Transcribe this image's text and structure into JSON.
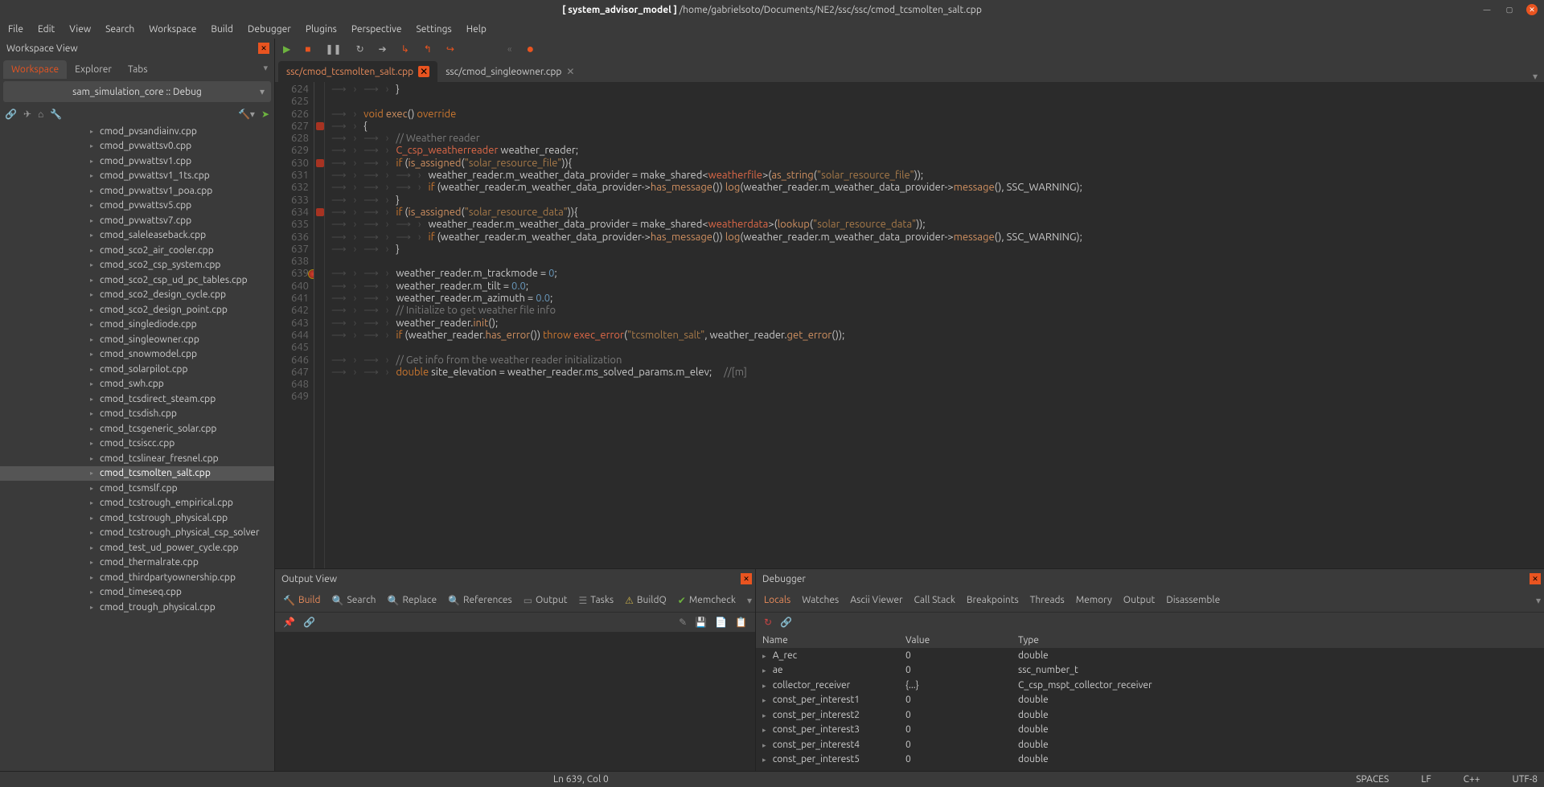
{
  "title_prefix": "[ system_advisor_model ]",
  "title_path": " /home/gabrielsoto/Documents/NE2/ssc/ssc/cmod_tcsmolten_salt.cpp",
  "menu": [
    "File",
    "Edit",
    "View",
    "Search",
    "Workspace",
    "Build",
    "Debugger",
    "Plugins",
    "Perspective",
    "Settings",
    "Help"
  ],
  "workspace": {
    "header": "Workspace View",
    "tabs": [
      "Workspace",
      "Explorer",
      "Tabs"
    ],
    "active_tab": 0,
    "selected_target": "sam_simulation_core :: Debug",
    "files": [
      "cmod_pvsandiainv.cpp",
      "cmod_pvwattsv0.cpp",
      "cmod_pvwattsv1.cpp",
      "cmod_pvwattsv1_1ts.cpp",
      "cmod_pvwattsv1_poa.cpp",
      "cmod_pvwattsv5.cpp",
      "cmod_pvwattsv7.cpp",
      "cmod_saleleaseback.cpp",
      "cmod_sco2_air_cooler.cpp",
      "cmod_sco2_csp_system.cpp",
      "cmod_sco2_csp_ud_pc_tables.cpp",
      "cmod_sco2_design_cycle.cpp",
      "cmod_sco2_design_point.cpp",
      "cmod_singlediode.cpp",
      "cmod_singleowner.cpp",
      "cmod_snowmodel.cpp",
      "cmod_solarpilot.cpp",
      "cmod_swh.cpp",
      "cmod_tcsdirect_steam.cpp",
      "cmod_tcsdish.cpp",
      "cmod_tcsgeneric_solar.cpp",
      "cmod_tcsiscc.cpp",
      "cmod_tcslinear_fresnel.cpp",
      "cmod_tcsmolten_salt.cpp",
      "cmod_tcsmslf.cpp",
      "cmod_tcstrough_empirical.cpp",
      "cmod_tcstrough_physical.cpp",
      "cmod_tcstrough_physical_csp_solver",
      "cmod_test_ud_power_cycle.cpp",
      "cmod_thermalrate.cpp",
      "cmod_thirdpartyownership.cpp",
      "cmod_timeseq.cpp",
      "cmod_trough_physical.cpp"
    ],
    "selected_file_index": 23
  },
  "editor_tabs": [
    {
      "label": "ssc/cmod_tcsmolten_salt.cpp",
      "active": true
    },
    {
      "label": "ssc/cmod_singleowner.cpp",
      "active": false
    }
  ],
  "editor": {
    "first_line": 624,
    "breakpoint_line": 639,
    "fold_lines": [
      627,
      630,
      634
    ],
    "lines_html": [
      "        }",
      "",
      "    <span class='kw'>void</span> <span class='fn'>exec</span>() <span class='kw'>override</span>",
      "    {",
      "        <span class='cmt'>// Weather reader</span>",
      "        <span class='cls'>C_csp_weatherreader</span> weather_reader;",
      "        <span class='kw'>if</span> (<span class='fn'>is_assigned</span>(<span class='str'>\"solar_resource_file\"</span>)){",
      "            weather_reader.m_weather_data_provider = make_shared&lt;<span class='cls'>weatherfile</span>&gt;(<span class='fn'>as_string</span>(<span class='str'>\"solar_resource_file\"</span>));",
      "            <span class='kw'>if</span> (weather_reader.m_weather_data_provider-&gt;<span class='fn'>has_message</span>()) <span class='log'>log</span>(weather_reader.m_weather_data_provider-&gt;<span class='fn'>message</span>(), SSC_WARNING);",
      "        }",
      "        <span class='kw'>if</span> (<span class='fn'>is_assigned</span>(<span class='str'>\"solar_resource_data\"</span>)){",
      "            weather_reader.m_weather_data_provider = make_shared&lt;<span class='cls'>weatherdata</span>&gt;(<span class='fn'>lookup</span>(<span class='str'>\"solar_resource_data\"</span>));",
      "            <span class='kw'>if</span> (weather_reader.m_weather_data_provider-&gt;<span class='fn'>has_message</span>()) <span class='log'>log</span>(weather_reader.m_weather_data_provider-&gt;<span class='fn'>message</span>(), SSC_WARNING);",
      "        }",
      "",
      "        weather_reader.m_trackmode = <span class='num'>0</span>;",
      "        weather_reader.m_tilt = <span class='num'>0.0</span>;",
      "        weather_reader.m_azimuth = <span class='num'>0.0</span>;",
      "        <span class='cmt'>// Initialize to get weather file info</span>",
      "        weather_reader.<span class='fn'>init</span>();",
      "        <span class='kw'>if</span> (weather_reader.<span class='fn'>has_error</span>()) <span class='kw'>throw</span> <span class='err'>exec_error</span>(<span class='str'>\"tcsmolten_salt\"</span>, weather_reader.<span class='fn'>get_error</span>());",
      "",
      "        <span class='cmt'>// Get info from the weather reader initialization</span>",
      "        <span class='kw'>double</span> site_elevation = weather_reader.ms_solved_params.m_elev;     <span class='cmt'>//[m]</span>",
      "",
      ""
    ]
  },
  "output_panel": {
    "title": "Output View",
    "tabs": [
      "Build",
      "Search",
      "Replace",
      "References",
      "Output",
      "Tasks",
      "BuildQ",
      "Memcheck"
    ],
    "active": 0
  },
  "debugger_panel": {
    "title": "Debugger",
    "tabs": [
      "Locals",
      "Watches",
      "Ascii Viewer",
      "Call Stack",
      "Breakpoints",
      "Threads",
      "Memory",
      "Output",
      "Disassemble"
    ],
    "active": 0,
    "columns": [
      "Name",
      "Value",
      "Type"
    ],
    "locals": [
      {
        "name": "A_rec",
        "value": "0",
        "type": "double"
      },
      {
        "name": "ae",
        "value": "0",
        "type": "ssc_number_t"
      },
      {
        "name": "collector_receiver",
        "value": "{...}",
        "type": "C_csp_mspt_collector_receiver"
      },
      {
        "name": "const_per_interest1",
        "value": "0",
        "type": "double"
      },
      {
        "name": "const_per_interest2",
        "value": "0",
        "type": "double"
      },
      {
        "name": "const_per_interest3",
        "value": "0",
        "type": "double"
      },
      {
        "name": "const_per_interest4",
        "value": "0",
        "type": "double"
      },
      {
        "name": "const_per_interest5",
        "value": "0",
        "type": "double"
      }
    ]
  },
  "status": {
    "pos": "Ln 639, Col 0",
    "indent": "SPACES",
    "eol": "LF",
    "lang": "C++",
    "enc": "UTF-8"
  }
}
